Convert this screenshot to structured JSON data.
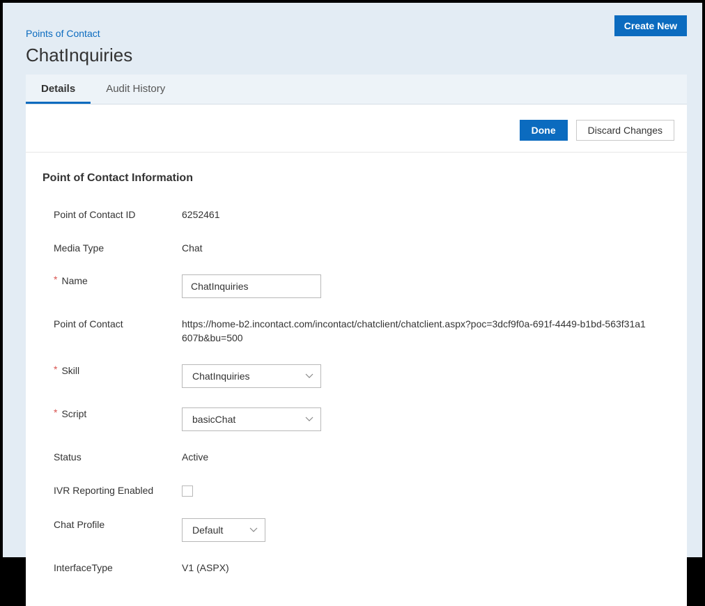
{
  "header": {
    "create_new": "Create New",
    "breadcrumb": "Points of Contact",
    "title": "ChatInquiries"
  },
  "tabs": {
    "details": "Details",
    "audit_history": "Audit History"
  },
  "actions": {
    "done": "Done",
    "discard": "Discard Changes"
  },
  "section": {
    "title": "Point of Contact Information"
  },
  "fields": {
    "poc_id": {
      "label": "Point of Contact ID",
      "value": "6252461"
    },
    "media_type": {
      "label": "Media Type",
      "value": "Chat"
    },
    "name": {
      "label": "Name",
      "value": "ChatInquiries"
    },
    "poc": {
      "label": "Point of Contact",
      "value": "https://home-b2.incontact.com/incontact/chatclient/chatclient.aspx?poc=3dcf9f0a-691f-4449-b1bd-563f31a1607b&bu=500"
    },
    "skill": {
      "label": "Skill",
      "value": "ChatInquiries"
    },
    "script": {
      "label": "Script",
      "value": "basicChat"
    },
    "status": {
      "label": "Status",
      "value": "Active"
    },
    "ivr": {
      "label": "IVR Reporting Enabled",
      "checked": false
    },
    "chat_profile": {
      "label": "Chat Profile",
      "value": "Default"
    },
    "interface_type": {
      "label": "InterfaceType",
      "value": "V1 (ASPX)"
    }
  },
  "required_mark": "*"
}
